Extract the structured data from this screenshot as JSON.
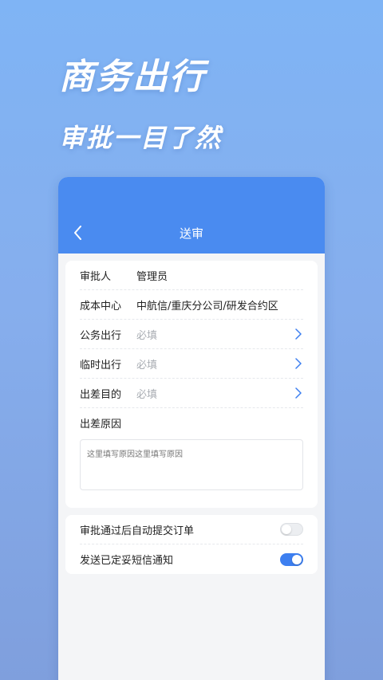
{
  "hero": {
    "line1": "商务出行",
    "line2": "审批一目了然"
  },
  "header": {
    "title": "送审"
  },
  "form": {
    "approver": {
      "label": "审批人",
      "value": "管理员"
    },
    "cost_center": {
      "label": "成本中心",
      "value": "中航信/重庆分公司/研发合约区"
    },
    "official_trip": {
      "label": "公务出行",
      "placeholder": "必填"
    },
    "temporary_trip": {
      "label": "临时出行",
      "placeholder": "必填"
    },
    "trip_purpose": {
      "label": "出差目的",
      "placeholder": "必填"
    },
    "trip_reason": {
      "label": "出差原因",
      "placeholder": "这里填写原因这里填写原因"
    }
  },
  "settings": {
    "auto_submit": {
      "label": "审批通过后自动提交订单",
      "enabled": false
    },
    "sms_notify": {
      "label": "发送已定妥短信通知",
      "enabled": true
    }
  },
  "colors": {
    "accent": "#3d7ff0",
    "header": "#4a8bf0"
  },
  "icons": {
    "back": "chevron-left-icon",
    "row_arrow": "chevron-right-icon"
  }
}
